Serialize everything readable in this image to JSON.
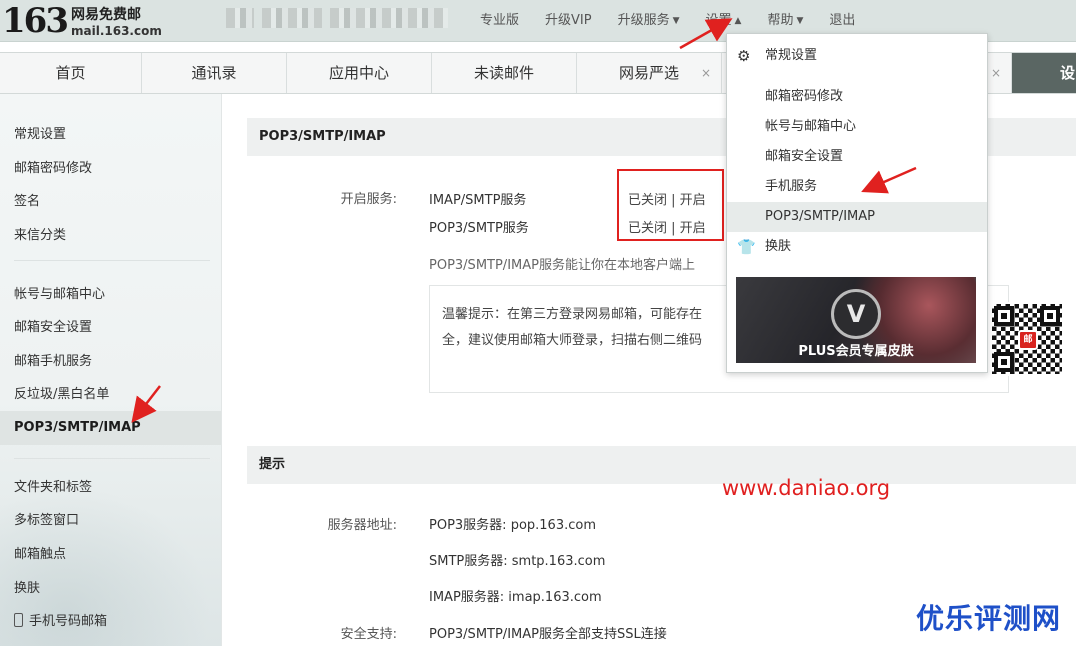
{
  "header": {
    "logo_number": "163",
    "logo_cn": "网易免费邮",
    "logo_domain": "mail.163.com",
    "nav": [
      "专业版",
      "升级VIP",
      "升级服务",
      "设置",
      "帮助",
      "退出"
    ]
  },
  "tabs": [
    {
      "label": "首页"
    },
    {
      "label": "通讯录"
    },
    {
      "label": "应用中心"
    },
    {
      "label": "未读邮件"
    },
    {
      "label": "网易严选",
      "close": "×"
    },
    {
      "close": "×"
    },
    {
      "close": "×"
    }
  ],
  "active_tab": "设",
  "sidebar": {
    "group1": [
      "常规设置",
      "邮箱密码修改",
      "签名",
      "来信分类"
    ],
    "group2": [
      "帐号与邮箱中心",
      "邮箱安全设置",
      "邮箱手机服务",
      "反垃圾/黑白名单",
      "POP3/SMTP/IMAP"
    ],
    "group3": [
      "文件夹和标签",
      "多标签窗口",
      "邮箱触点",
      "换肤",
      "手机号码邮箱"
    ]
  },
  "main": {
    "section1_title": "POP3/SMTP/IMAP",
    "enable_label": "开启服务:",
    "services": [
      {
        "name": "IMAP/SMTP服务",
        "status": "已关闭 | 开启"
      },
      {
        "name": "POP3/SMTP服务",
        "status": "已关闭 | 开启"
      }
    ],
    "service_desc": "POP3/SMTP/IMAP服务能让你在本地客户端上",
    "tip_line1": "温馨提示：在第三方登录网易邮箱，可能存在",
    "tip_line2": "全，建议使用邮箱大师登录，扫描右侧二维码",
    "section2_title": "提示",
    "server_label": "服务器地址:",
    "servers": [
      "POP3服务器: pop.163.com",
      "SMTP服务器: smtp.163.com",
      "IMAP服务器: imap.163.com"
    ],
    "security_label": "安全支持:",
    "security_value": "POP3/SMTP/IMAP服务全部支持SSL连接"
  },
  "dropdown": {
    "items": [
      "常规设置",
      "邮箱密码修改",
      "帐号与邮箱中心",
      "邮箱安全设置",
      "手机服务",
      "POP3/SMTP/IMAP",
      "换肤"
    ],
    "banner_badge": "V",
    "banner_text": "PLUS会员专属皮肤",
    "qr_badge": "邮"
  },
  "watermark": "www.daniao.org",
  "brand": "优乐评测网",
  "colors": {
    "accent_red": "#e0211f",
    "brand_blue": "#1e50c8",
    "active_tab_bg": "#5a6663"
  }
}
